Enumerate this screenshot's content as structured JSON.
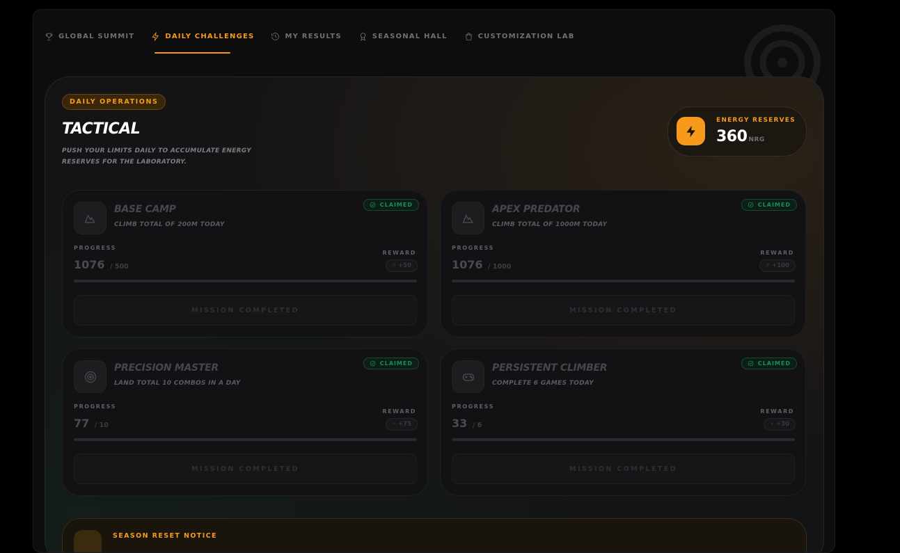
{
  "nav": {
    "items": [
      {
        "label": "GLOBAL SUMMIT",
        "icon": "trophy-icon",
        "active": false
      },
      {
        "label": "DAILY CHALLENGES",
        "icon": "lightning-icon",
        "active": true
      },
      {
        "label": "MY RESULTS",
        "icon": "history-icon",
        "active": false
      },
      {
        "label": "SEASONAL HALL",
        "icon": "award-icon",
        "active": false
      },
      {
        "label": "CUSTOMIZATION LAB",
        "icon": "shopping-bag-icon",
        "active": false
      }
    ]
  },
  "header": {
    "badge": "DAILY OPERATIONS",
    "title": "TACTICAL",
    "subtitle": "PUSH YOUR LIMITS DAILY TO ACCUMULATE ENERGY RESERVES FOR THE LABORATORY."
  },
  "energy": {
    "label": "ENERGY RESERVES",
    "value": "360",
    "unit": "NRG"
  },
  "cards": [
    {
      "title": "BASE CAMP",
      "description": "CLIMB TOTAL OF 200M TODAY",
      "icon": "mountain-icon",
      "status": "CLAIMED",
      "progress_label": "PROGRESS",
      "progress_value": "1076",
      "progress_total": "/ 500",
      "reward_label": "REWARD",
      "reward": "+50",
      "action": "MISSION COMPLETED"
    },
    {
      "title": "APEX PREDATOR",
      "description": "CLIMB TOTAL OF 1000M TODAY",
      "icon": "mountain-icon",
      "status": "CLAIMED",
      "progress_label": "PROGRESS",
      "progress_value": "1076",
      "progress_total": "/ 1000",
      "reward_label": "REWARD",
      "reward": "+100",
      "action": "MISSION COMPLETED"
    },
    {
      "title": "PRECISION MASTER",
      "description": "LAND TOTAL 10 COMBOS IN A DAY",
      "icon": "target-icon",
      "status": "CLAIMED",
      "progress_label": "PROGRESS",
      "progress_value": "77",
      "progress_total": "/ 10",
      "reward_label": "REWARD",
      "reward": "+75",
      "action": "MISSION COMPLETED"
    },
    {
      "title": "PERSISTENT CLIMBER",
      "description": "COMPLETE 6 GAMES TODAY",
      "icon": "gamepad-icon",
      "status": "CLAIMED",
      "progress_label": "PROGRESS",
      "progress_value": "33",
      "progress_total": "/ 6",
      "reward_label": "REWARD",
      "reward": "+30",
      "action": "MISSION COMPLETED"
    }
  ],
  "notice": {
    "title": "SEASON RESET NOTICE"
  },
  "colors": {
    "accent": "#f79a1b",
    "claimed": "#1d8c5b",
    "background": "#0d0d0e"
  }
}
